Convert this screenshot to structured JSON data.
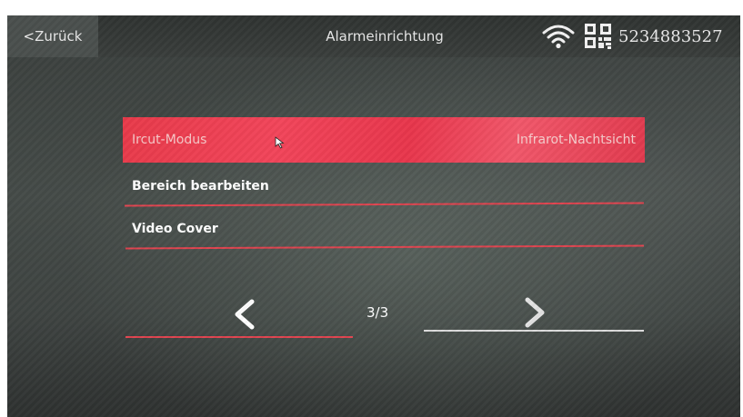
{
  "header": {
    "back_label": "<Zurück",
    "title": "Alarmeinrichtung",
    "device_id": "5234883527",
    "icons": [
      "wifi-icon",
      "qr-code-icon"
    ]
  },
  "menu": {
    "items": [
      {
        "label": "Ircut-Modus",
        "value": "Infrarot-Nachtsicht",
        "selected": true
      },
      {
        "label": "Bereich bearbeiten",
        "value": ""
      },
      {
        "label": "Video Cover",
        "value": ""
      }
    ]
  },
  "pager": {
    "text": "3/3"
  },
  "colors": {
    "accent": "#e83a4a",
    "underline": "#e0444f",
    "background": "#3f4442"
  }
}
